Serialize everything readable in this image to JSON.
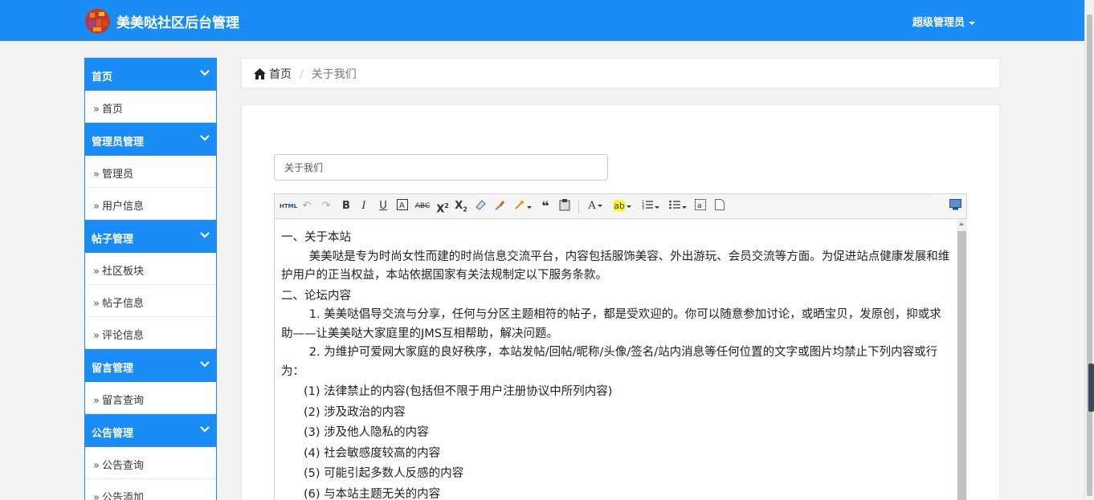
{
  "app": {
    "title": "美美哒社区后台管理",
    "user": "超级管理员"
  },
  "sidebar": {
    "groups": [
      {
        "label": "首页",
        "items": [
          "首页"
        ]
      },
      {
        "label": "管理员管理",
        "items": [
          "管理员",
          "用户信息"
        ]
      },
      {
        "label": "帖子管理",
        "items": [
          "社区板块",
          "帖子信息",
          "评论信息"
        ]
      },
      {
        "label": "留言管理",
        "items": [
          "留言查询"
        ]
      },
      {
        "label": "公告管理",
        "items": [
          "公告查询",
          "公告添加"
        ]
      }
    ],
    "item_prefix": "»"
  },
  "breadcrumb": {
    "home": "首页",
    "separator": "/",
    "current": "关于我们"
  },
  "form": {
    "title_value": "关于我们"
  },
  "editor": {
    "toolbar_html_label": "HTML",
    "content": [
      {
        "style": "plain",
        "text": "一、关于本站"
      },
      {
        "style": "ind2",
        "text": "美美哒是专为时尚女性而建的时尚信息交流平台，内容包括服饰美容、外出游玩、会员交流等方面。为促进站点健康发展和维护用户的正当权益，本站依据国家有关法规制定以下服务条款。"
      },
      {
        "style": "plain",
        "text": "二、论坛内容"
      },
      {
        "style": "ind2",
        "text": "1. 美美哒倡导交流与分享，任何与分区主题相符的帖子，都是受欢迎的。你可以随意参加讨论，或晒宝贝，发原创，抑或求助——让美美哒大家庭里的JMS互相帮助，解决问题。"
      },
      {
        "style": "ind2",
        "text": "2. 为维护可爱网大家庭的良好秩序，本站发帖/回帖/昵称/头像/签名/站内消息等任何位置的文字或图片均禁止下列内容或行为："
      },
      {
        "style": "ind1",
        "text": "(1) 法律禁止的内容(包括但不限于用户注册协议中所列内容)"
      },
      {
        "style": "ind1",
        "text": "(2) 涉及政治的内容"
      },
      {
        "style": "ind1",
        "text": "(3) 涉及他人隐私的内容"
      },
      {
        "style": "ind1",
        "text": "(4) 社会敏感度较高的内容"
      },
      {
        "style": "ind1",
        "text": "(5) 可能引起多数人反感的内容"
      },
      {
        "style": "ind1",
        "text": "(6) 与本站主题无关的内容"
      }
    ]
  },
  "colors": {
    "primary": "#1a8cf5",
    "panel": "#ffffff",
    "background": "#f2f2f2"
  }
}
